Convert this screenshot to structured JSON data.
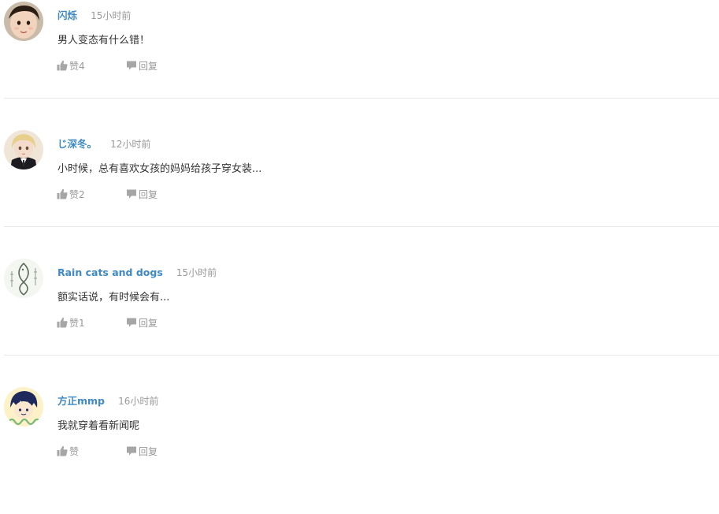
{
  "comments": [
    {
      "username": "闪烁",
      "time": "15小时前",
      "text": "男人变态有什么错！",
      "like_label": "赞4",
      "reply_label": "回复",
      "avatar": "child-photo-avatar"
    },
    {
      "username": "じ深冬。",
      "time": "12小时前",
      "text": "小时候，总有喜欢女孩的妈妈给孩子穿女装...",
      "like_label": "赞2",
      "reply_label": "回复",
      "avatar": "doll-avatar"
    },
    {
      "username": "Rain cats and dogs",
      "time": "15小时前",
      "text": "额实话说，有时候会有...",
      "like_label": "赞1",
      "reply_label": "回复",
      "avatar": "fish-calligraphy-avatar"
    },
    {
      "username": "方正mmp",
      "time": "16小时前",
      "text": "我就穿着看新闻呢",
      "like_label": "赞",
      "reply_label": "回复",
      "avatar": "cartoon-avatar"
    }
  ],
  "colors": {
    "username": "#3e8ac7",
    "meta": "#999999",
    "text": "#333333",
    "divider": "#e8e8e8"
  },
  "icons": {
    "like": "thumbs-up-icon",
    "reply": "speech-bubble-icon"
  }
}
